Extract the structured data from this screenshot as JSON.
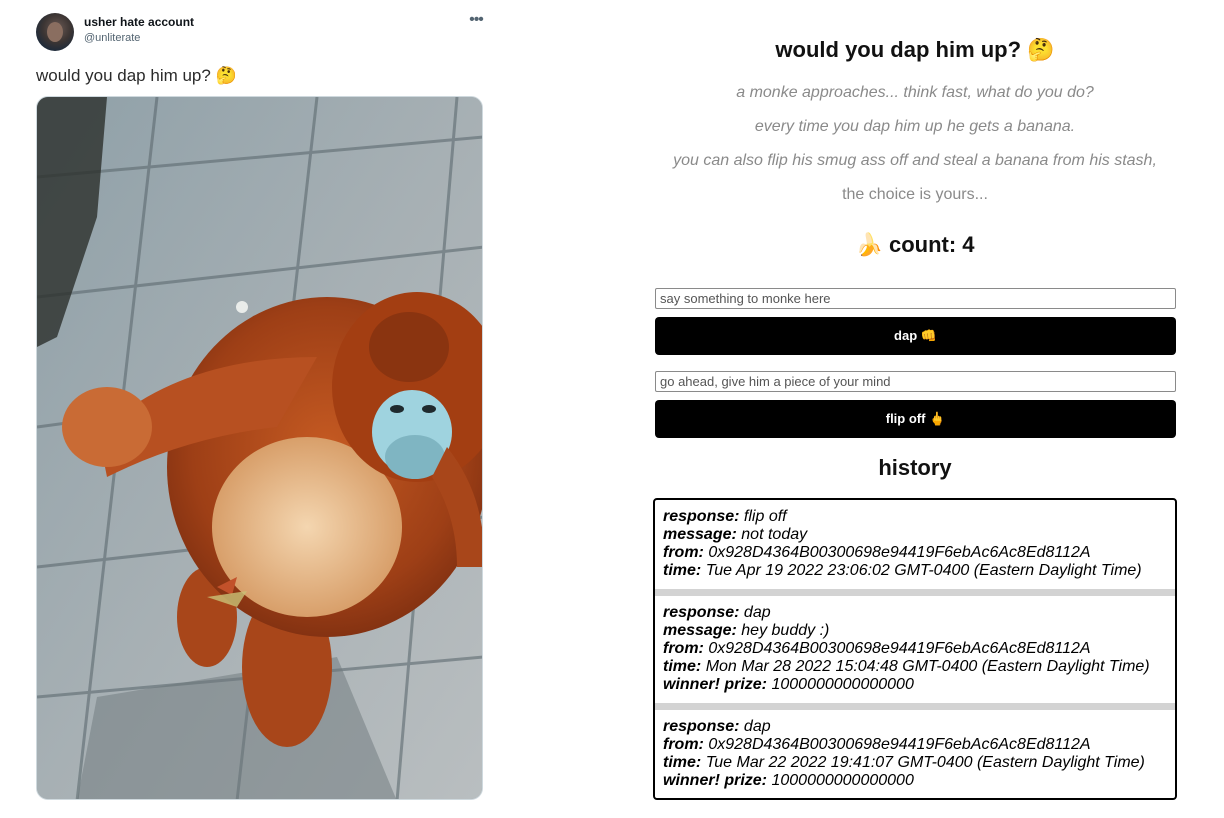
{
  "tweet": {
    "user_name": "usher hate account",
    "handle": "@unliterate",
    "more_icon": "more-horizontal-icon",
    "text": "would you dap him up? 🤔"
  },
  "app": {
    "title": "would you dap him up? 🤔",
    "description": [
      "a monke approaches... think fast, what do you do?",
      "every time you dap him up he gets a banana.",
      "you can also flip his smug ass off and steal a banana from his stash,",
      "the choice is yours..."
    ],
    "count_label": "🍌 count: 4",
    "dap_input_placeholder": "say something to monke here",
    "dap_button_label": "dap 👊",
    "flip_input_placeholder": "go ahead, give him a piece of your mind",
    "flip_button_label": "flip off 🖕",
    "history_title": "history",
    "labels": {
      "response": "response:",
      "message": "message:",
      "from": "from:",
      "time": "time:",
      "prize": "winner! prize:"
    },
    "history": [
      {
        "response": "flip off",
        "message": "not today",
        "from": "0x928D4364B00300698e94419F6ebAc6Ac8Ed8112A",
        "time": "Tue Apr 19 2022 23:06:02 GMT-0400 (Eastern Daylight Time)"
      },
      {
        "response": "dap",
        "message": "hey buddy :)",
        "from": "0x928D4364B00300698e94419F6ebAc6Ac8Ed8112A",
        "time": "Mon Mar 28 2022 15:04:48 GMT-0400 (Eastern Daylight Time)",
        "prize": "1000000000000000"
      },
      {
        "response": "dap",
        "from": "0x928D4364B00300698e94419F6ebAc6Ac8Ed8112A",
        "time": "Tue Mar 22 2022 19:41:07 GMT-0400 (Eastern Daylight Time)",
        "prize": "1000000000000000"
      }
    ]
  }
}
